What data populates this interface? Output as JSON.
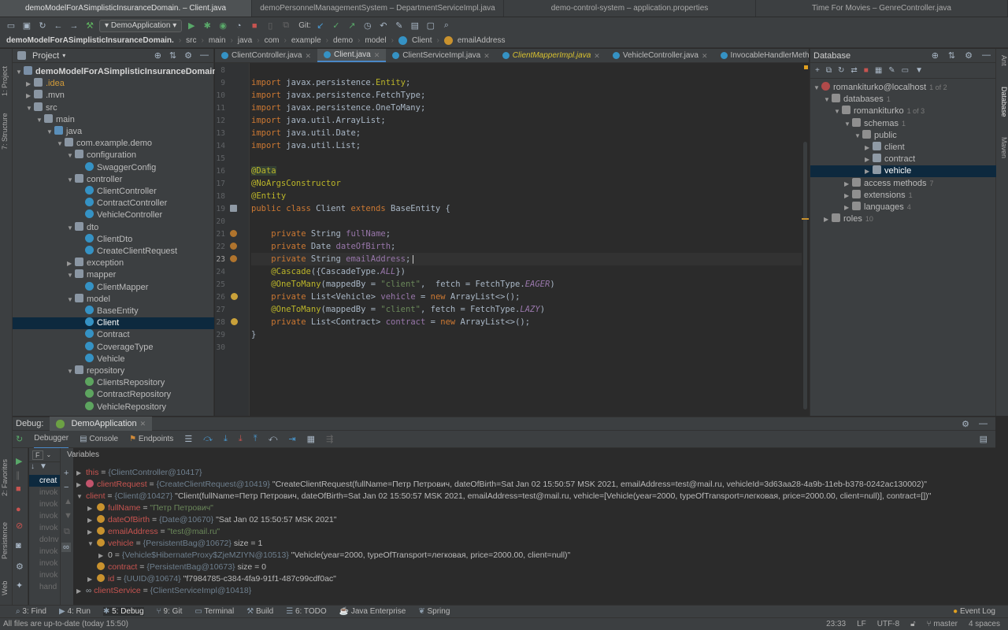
{
  "window_tabs": [
    "demoModelForASimplisticInsuranceDomain. – Client.java",
    "demoPersonnelManagementSystem – DepartmentServiceImpl.java",
    "demo-control-system – application.properties",
    "Time For Movies – GenreController.java"
  ],
  "toolbar": {
    "run_config": "DemoApplication",
    "git_label": "Git:"
  },
  "breadcrumbs": [
    "demoModelForASimplisticInsuranceDomain.",
    "src",
    "main",
    "java",
    "com",
    "example",
    "demo",
    "model",
    "Client",
    "emailAddress"
  ],
  "left_strip": {
    "project": "1: Project",
    "structure": "7: Structure",
    "favorites": "2: Favorites",
    "persistence": "Persistence",
    "web": "Web"
  },
  "right_strip": {
    "ant": "Ant",
    "database": "Database",
    "maven": "Maven"
  },
  "project": {
    "title": "Project",
    "tree": [
      {
        "label": "demoModelForASimplisticInsuranceDomain.",
        "depth": 0,
        "icon": "module",
        "open": true,
        "bold": true
      },
      {
        "label": ".idea",
        "depth": 1,
        "icon": "folder",
        "open": false,
        "color": "#d19a3a"
      },
      {
        "label": ".mvn",
        "depth": 1,
        "icon": "folder",
        "open": false
      },
      {
        "label": "src",
        "depth": 1,
        "icon": "folder",
        "open": true
      },
      {
        "label": "main",
        "depth": 2,
        "icon": "folder",
        "open": true
      },
      {
        "label": "java",
        "depth": 3,
        "icon": "src",
        "open": true
      },
      {
        "label": "com.example.demo",
        "depth": 4,
        "icon": "folder",
        "open": true
      },
      {
        "label": "configuration",
        "depth": 5,
        "icon": "folder",
        "open": true
      },
      {
        "label": "SwaggerConfig",
        "depth": 6,
        "icon": "cls"
      },
      {
        "label": "controller",
        "depth": 5,
        "icon": "folder",
        "open": true
      },
      {
        "label": "ClientController",
        "depth": 6,
        "icon": "cls"
      },
      {
        "label": "ContractController",
        "depth": 6,
        "icon": "cls"
      },
      {
        "label": "VehicleController",
        "depth": 6,
        "icon": "cls"
      },
      {
        "label": "dto",
        "depth": 5,
        "icon": "folder",
        "open": true
      },
      {
        "label": "ClientDto",
        "depth": 6,
        "icon": "cls"
      },
      {
        "label": "CreateClientRequest",
        "depth": 6,
        "icon": "cls"
      },
      {
        "label": "exception",
        "depth": 5,
        "icon": "folder",
        "open": false
      },
      {
        "label": "mapper",
        "depth": 5,
        "icon": "folder",
        "open": true
      },
      {
        "label": "ClientMapper",
        "depth": 6,
        "icon": "cls"
      },
      {
        "label": "model",
        "depth": 5,
        "icon": "folder",
        "open": true
      },
      {
        "label": "BaseEntity",
        "depth": 6,
        "icon": "cls"
      },
      {
        "label": "Client",
        "depth": 6,
        "icon": "cls",
        "selected": true
      },
      {
        "label": "Contract",
        "depth": 6,
        "icon": "cls"
      },
      {
        "label": "CoverageType",
        "depth": 6,
        "icon": "cls"
      },
      {
        "label": "Vehicle",
        "depth": 6,
        "icon": "cls"
      },
      {
        "label": "repository",
        "depth": 5,
        "icon": "folder",
        "open": true
      },
      {
        "label": "ClientsRepository",
        "depth": 6,
        "icon": "ifc"
      },
      {
        "label": "ContractRepository",
        "depth": 6,
        "icon": "ifc"
      },
      {
        "label": "VehicleRepository",
        "depth": 6,
        "icon": "ifc"
      }
    ]
  },
  "editor_tabs": [
    {
      "label": "ClientController.java",
      "active": false
    },
    {
      "label": "Client.java",
      "active": true
    },
    {
      "label": "ClientServiceImpl.java",
      "active": false
    },
    {
      "label": "ClientMapperImpl.java",
      "active": false,
      "color": "#d9c230"
    },
    {
      "label": "VehicleController.java",
      "active": false
    },
    {
      "label": "InvocableHandlerMethod.class",
      "active": false
    }
  ],
  "code": [
    {
      "n": "8",
      "html": ""
    },
    {
      "n": "9",
      "html": "<span class='kw'>import</span> javax.persistence.<span class='ann'>Entity</span>;"
    },
    {
      "n": "10",
      "html": "<span class='kw'>import</span> javax.persistence.FetchType;"
    },
    {
      "n": "11",
      "html": "<span class='kw'>import</span> javax.persistence.OneToMany;"
    },
    {
      "n": "12",
      "html": "<span class='kw'>import</span> java.util.ArrayList;"
    },
    {
      "n": "13",
      "html": "<span class='kw'>import</span> java.util.Date;"
    },
    {
      "n": "14",
      "html": "<span class='kw'>import</span> java.util.List;"
    },
    {
      "n": "15",
      "html": ""
    },
    {
      "n": "16",
      "html": "<span class='ann anhl'>@Data</span>"
    },
    {
      "n": "17",
      "html": "<span class='ann'>@NoArgsConstructor</span>"
    },
    {
      "n": "18",
      "html": "<span class='ann'>@Entity</span>"
    },
    {
      "n": "19",
      "html": "<span class='kw'>public class</span> Client <span class='kw'>extends</span> BaseEntity {"
    },
    {
      "n": "20",
      "html": ""
    },
    {
      "n": "21",
      "html": "    <span class='kw'>private</span> String <span class='fld'>fullName</span>;"
    },
    {
      "n": "22",
      "html": "    <span class='kw'>private</span> Date <span class='fld'>dateOfBirth</span>;"
    },
    {
      "n": "23",
      "html": "    <span class='kw'>private</span> String <span class='fld'>emailAddress</span>;",
      "current": true
    },
    {
      "n": "24",
      "html": "    <span class='ann'>@Cascade</span>({CascadeType.<span class='itc'>ALL</span>})"
    },
    {
      "n": "25",
      "html": "    <span class='ann'>@OneToMany</span>(mappedBy = <span class='str'>\"client\"</span>,  fetch = FetchType.<span class='itc'>EAGER</span>)"
    },
    {
      "n": "26",
      "html": "    <span class='kw'>private</span> List&lt;Vehicle&gt; <span class='fld'>vehicle</span> = <span class='kw'>new</span> ArrayList&lt;&gt;();"
    },
    {
      "n": "27",
      "html": "    <span class='ann'>@OneToMany</span>(mappedBy = <span class='str'>\"client\"</span>, fetch = FetchType.<span class='itc'>LAZY</span>)"
    },
    {
      "n": "28",
      "html": "    <span class='kw'>private</span> List&lt;Contract&gt; <span class='fld'>contract</span> = <span class='kw'>new</span> ArrayList&lt;&gt;();"
    },
    {
      "n": "29",
      "html": "}"
    },
    {
      "n": "30",
      "html": ""
    }
  ],
  "database": {
    "title": "Database",
    "tree": [
      {
        "label": "romankiturko@localhost",
        "badge": "1 of 2",
        "depth": 0,
        "icon": "db",
        "open": true
      },
      {
        "label": "databases",
        "badge": "1",
        "depth": 1,
        "icon": "grey",
        "open": true
      },
      {
        "label": "romankiturko",
        "badge": "1 of 3",
        "depth": 2,
        "icon": "grey",
        "open": true
      },
      {
        "label": "schemas",
        "badge": "1",
        "depth": 3,
        "icon": "grey",
        "open": true
      },
      {
        "label": "public",
        "badge": "",
        "depth": 4,
        "icon": "grey",
        "open": true
      },
      {
        "label": "client",
        "badge": "",
        "depth": 5,
        "icon": "tbl",
        "open": false
      },
      {
        "label": "contract",
        "badge": "",
        "depth": 5,
        "icon": "tbl",
        "open": false
      },
      {
        "label": "vehicle",
        "badge": "",
        "depth": 5,
        "icon": "tbl",
        "open": false,
        "selected": true
      },
      {
        "label": "access methods",
        "badge": "7",
        "depth": 3,
        "icon": "grey",
        "open": false
      },
      {
        "label": "extensions",
        "badge": "1",
        "depth": 3,
        "icon": "grey",
        "open": false
      },
      {
        "label": "languages",
        "badge": "4",
        "depth": 3,
        "icon": "grey",
        "open": false
      },
      {
        "label": "roles",
        "badge": "10",
        "depth": 1,
        "icon": "grey",
        "open": false
      }
    ]
  },
  "debug": {
    "label": "Debug:",
    "session": "DemoApplication",
    "tabs": [
      "Debugger",
      "Console",
      "Endpoints"
    ],
    "frames_label": "F",
    "variables_label": "Variables",
    "frames": [
      "creat",
      "invok",
      "invok",
      "invok",
      "invok",
      "doInv",
      "invok",
      "invok",
      "invok",
      "hand"
    ],
    "variables": [
      {
        "indent": 0,
        "arrow": "▶",
        "icon": "",
        "name": "this",
        "eq": " = ",
        "type": "{ClientController@10417}",
        "value": ""
      },
      {
        "indent": 0,
        "arrow": "▶",
        "icon": "p",
        "name": "clientRequest",
        "eq": " = ",
        "type": "{CreateClientRequest@10419}",
        "value": " \"CreateClientRequest(fullName=Петр Петрович, dateOfBirth=Sat Jan 02 15:50:57 MSK 2021, emailAddress=test@mail.ru, vehicleId=3d63aa28-4a9b-11eb-b378-0242ac130002)\""
      },
      {
        "indent": 0,
        "arrow": "▼",
        "icon": "",
        "name": "client",
        "eq": " = ",
        "type": "{Client@10427}",
        "value": " \"Client(fullName=Петр Петрович, dateOfBirth=Sat Jan 02 15:50:57 MSK 2021, emailAddress=test@mail.ru, vehicle=[Vehicle(year=2000, typeOfTransport=легковая, price=2000.00, client=null)], contract=[])\""
      },
      {
        "indent": 1,
        "arrow": "▶",
        "icon": "f",
        "name": "fullName",
        "eq": " = ",
        "type": "",
        "value": "\"Петр Петрович\"",
        "strval": true
      },
      {
        "indent": 1,
        "arrow": "▶",
        "icon": "f",
        "name": "dateOfBirth",
        "eq": " = ",
        "type": "{Date@10670}",
        "value": " \"Sat Jan 02 15:50:57 MSK 2021\""
      },
      {
        "indent": 1,
        "arrow": "▶",
        "icon": "f",
        "name": "emailAddress",
        "eq": " = ",
        "type": "",
        "value": "\"test@mail.ru\"",
        "strval": true
      },
      {
        "indent": 1,
        "arrow": "▼",
        "icon": "f",
        "name": "vehicle",
        "eq": " = ",
        "type": "{PersistentBag@10672}",
        "value": "  size = 1"
      },
      {
        "indent": 2,
        "arrow": "▶",
        "icon": "",
        "name": "0",
        "eq": " = ",
        "type": "{Vehicle$HibernateProxy$ZjeMZIYN@10513}",
        "value": " \"Vehicle(year=2000, typeOfTransport=легковая, price=2000.00, client=null)\"",
        "plainname": true
      },
      {
        "indent": 1,
        "arrow": "",
        "icon": "f",
        "name": "contract",
        "eq": " = ",
        "type": "{PersistentBag@10673}",
        "value": "  size = 0"
      },
      {
        "indent": 1,
        "arrow": "▶",
        "icon": "f",
        "name": "id",
        "eq": " = ",
        "type": "{UUID@10674}",
        "value": " \"f7984785-c384-4fa9-91f1-487c99cdf0ac\""
      },
      {
        "indent": 0,
        "arrow": "▶",
        "icon": "oo",
        "name": "clientService",
        "eq": " = ",
        "type": "{ClientServiceImpl@10418}",
        "value": ""
      }
    ]
  },
  "bottom_tabs": [
    "3: Find",
    "4: Run",
    "5: Debug",
    "9: Git",
    "Terminal",
    "Build",
    "6: TODO",
    "Java Enterprise",
    "Spring"
  ],
  "bottom_right": "Event Log",
  "status": {
    "message": "All files are up-to-date (today 15:50)",
    "position": "23:33",
    "line_sep": "LF",
    "encoding": "UTF-8",
    "branch": "master",
    "indent": "4 spaces"
  }
}
